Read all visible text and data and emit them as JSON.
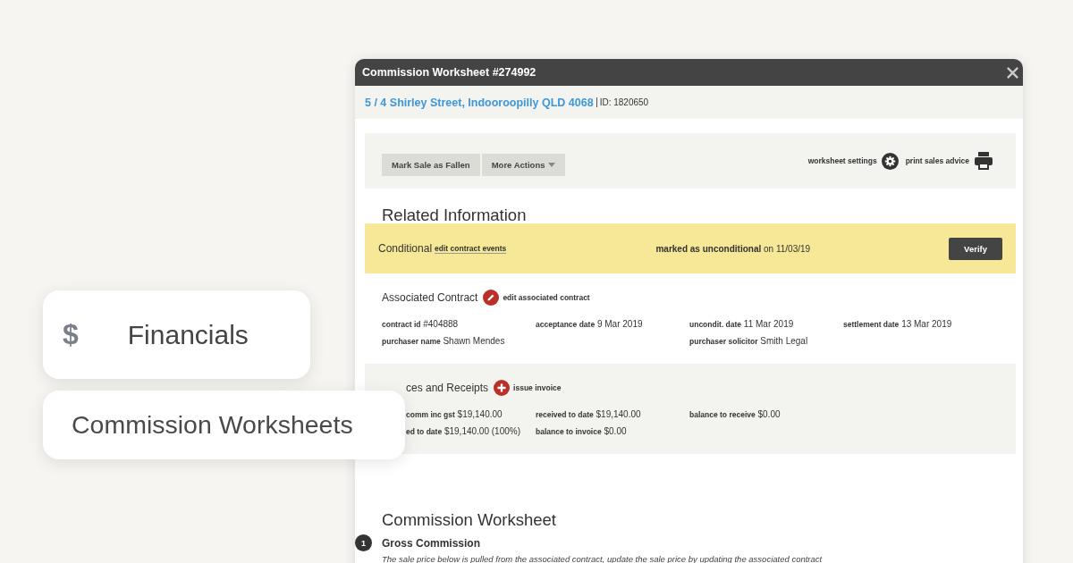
{
  "side_menu": [
    {
      "kind": "section",
      "icon": "$",
      "label": "Financials"
    },
    {
      "kind": "item",
      "label": "Commission Worksheets"
    }
  ],
  "window": {
    "title": "Commission Worksheet #274992"
  },
  "address": {
    "link": "5 / 4 Shirley Street, Indooroopilly QLD 4068",
    "id": "ID: 1820650"
  },
  "actions": {
    "buttons": [
      {
        "label": "Mark Sale as Fallen",
        "dropdown": false
      },
      {
        "label": "More Actions",
        "dropdown": true
      }
    ],
    "links": [
      {
        "kind": "gear",
        "label": "worksheet settings"
      },
      {
        "kind": "printer",
        "label": "print sales advice"
      }
    ]
  },
  "related_heading": "Related Information",
  "status_band": {
    "status": "Conditional",
    "link": "edit contract events",
    "note": "**marked as unconditional** on 11/03/19",
    "button": "Verify"
  },
  "associated_contract": {
    "title": "Associated Contract",
    "kind": "edit",
    "action": "edit associated contract",
    "rows": [
      [
        {
          "label": "contract id",
          "value": "#404888"
        },
        {
          "label": "acceptance date",
          "value": "9 Mar 2019"
        },
        {
          "label": "uncondit. date",
          "value": "11 Mar 2019"
        },
        {
          "label": "settlement date",
          "value": "13 Mar 2019"
        }
      ],
      [
        {
          "label": "purchaser name",
          "value": "Shawn Mendes"
        },
        null,
        {
          "label": "purchaser solicitor",
          "value": "Smith Legal"
        },
        null
      ]
    ]
  },
  "invoices": {
    "title": "ces and Receipts",
    "kind": "add",
    "action": "issue invoice",
    "rows": [
      [
        {
          "label": "comm inc gst",
          "value": "$19,140.00"
        },
        {
          "label": "received to date",
          "value": "$19,140.00"
        },
        {
          "label": "balance to receive",
          "value": "$0.00"
        },
        null
      ],
      [
        {
          "label": "ed to date",
          "value": "$19,140.00 (100%)"
        },
        {
          "label": "balance to invoice",
          "value": "$0.00"
        },
        null,
        null
      ]
    ]
  },
  "worksheet": {
    "title": "Commission Worksheet",
    "steps": [
      {
        "number": "1",
        "title": "Gross Commission",
        "description": "The sale price below is pulled from the associated contract, update the sale price by updating the associated contract"
      }
    ]
  }
}
